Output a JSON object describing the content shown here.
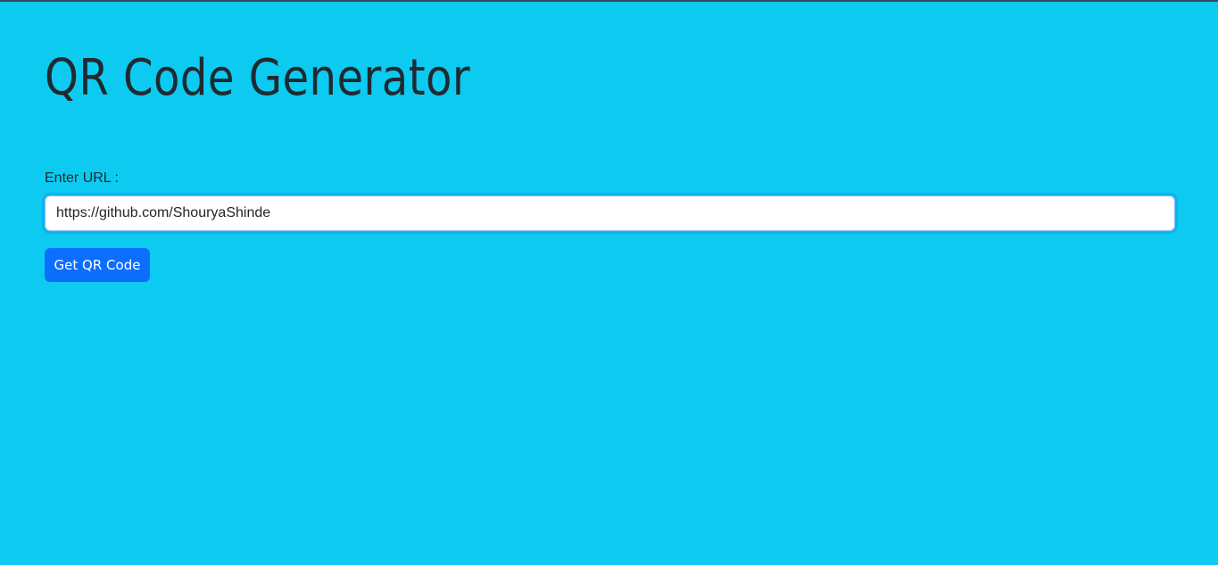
{
  "page": {
    "title": "QR Code Generator"
  },
  "form": {
    "url_label": "Enter URL :",
    "url_value": "https://github.com/ShouryaShinde",
    "submit_label": "Get QR Code"
  },
  "colors": {
    "background": "#0dcaf0",
    "button": "#0d6efd",
    "text": "#212529"
  }
}
